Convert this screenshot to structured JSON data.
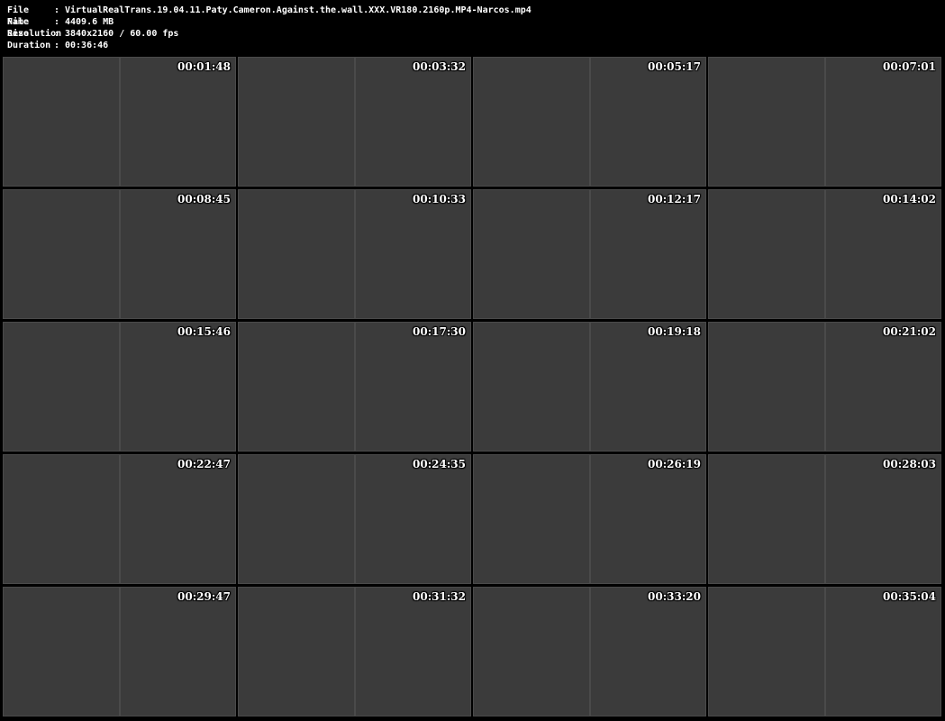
{
  "header": {
    "file_name_label": "File Name",
    "file_name": "VirtualRealTrans.19.04.11.Paty.Cameron.Against.the.wall.XXX.VR180.2160p.MP4-Narcos.mp4",
    "file_size_label": "File Size",
    "file_size": "4409.6 MB",
    "resolution_label": "Resolution",
    "resolution": "3840x2160 / 60.00 fps",
    "duration_label": "Duration",
    "duration": "00:36:46",
    "separator": ":"
  },
  "thumbnails": [
    "00:01:48",
    "00:03:32",
    "00:05:17",
    "00:07:01",
    "00:08:45",
    "00:10:33",
    "00:12:17",
    "00:14:02",
    "00:15:46",
    "00:17:30",
    "00:19:18",
    "00:21:02",
    "00:22:47",
    "00:24:35",
    "00:26:19",
    "00:28:03",
    "00:29:47",
    "00:31:32",
    "00:33:20",
    "00:35:04"
  ]
}
